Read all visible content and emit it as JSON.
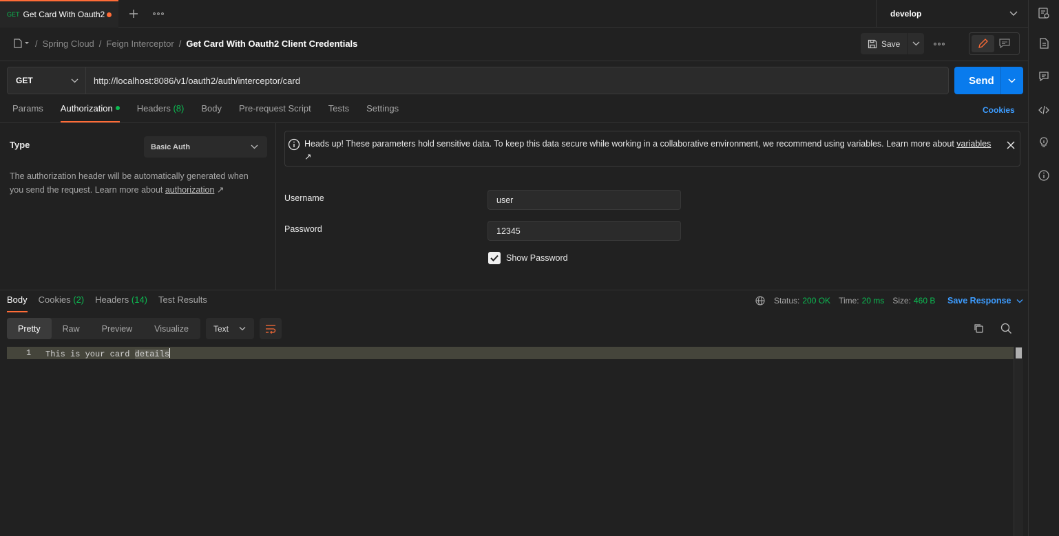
{
  "tabbar": {
    "tab": {
      "method": "GET",
      "title": "Get Card With Oauth2"
    },
    "environment": "develop"
  },
  "breadcrumb": {
    "items": [
      "Spring Cloud",
      "Feign Interceptor"
    ],
    "current": "Get Card With Oauth2 Client Credentials"
  },
  "toolbar": {
    "save_label": "Save"
  },
  "request": {
    "method": "GET",
    "url": "http://localhost:8086/v1/oauth2/auth/interceptor/card",
    "send_label": "Send"
  },
  "request_tabs": {
    "params": "Params",
    "authorization": "Authorization",
    "headers": "Headers",
    "headers_count": "(8)",
    "body": "Body",
    "prerequest": "Pre-request Script",
    "tests": "Tests",
    "settings": "Settings",
    "cookies": "Cookies"
  },
  "auth": {
    "type_label": "Type",
    "type_value": "Basic Auth",
    "description": "The authorization header will be automatically generated when you send the request. Learn more about ",
    "description_link": "authorization",
    "notice_text": "Heads up! These parameters hold sensitive data. To keep this data secure while working in a collaborative environment, we recommend using variables. Learn more about ",
    "notice_link": "variables",
    "username_label": "Username",
    "username_value": "user",
    "password_label": "Password",
    "password_value": "12345",
    "show_password_label": "Show Password"
  },
  "response": {
    "tabs": {
      "body": "Body",
      "cookies": "Cookies",
      "cookies_count": "(2)",
      "headers": "Headers",
      "headers_count": "(14)",
      "test_results": "Test Results"
    },
    "status_label": "Status:",
    "status_value": "200 OK",
    "time_label": "Time:",
    "time_value": "20 ms",
    "size_label": "Size:",
    "size_value": "460 B",
    "save_response": "Save Response",
    "formats": {
      "pretty": "Pretty",
      "raw": "Raw",
      "preview": "Preview",
      "visualize": "Visualize"
    },
    "language": "Text",
    "line_number": "1",
    "body_text_a": "This is your card ",
    "body_text_b": "details"
  },
  "colors": {
    "accent": "#ff6c37",
    "send": "#097bed",
    "success": "#0cbb52",
    "link": "#3d9cff"
  }
}
